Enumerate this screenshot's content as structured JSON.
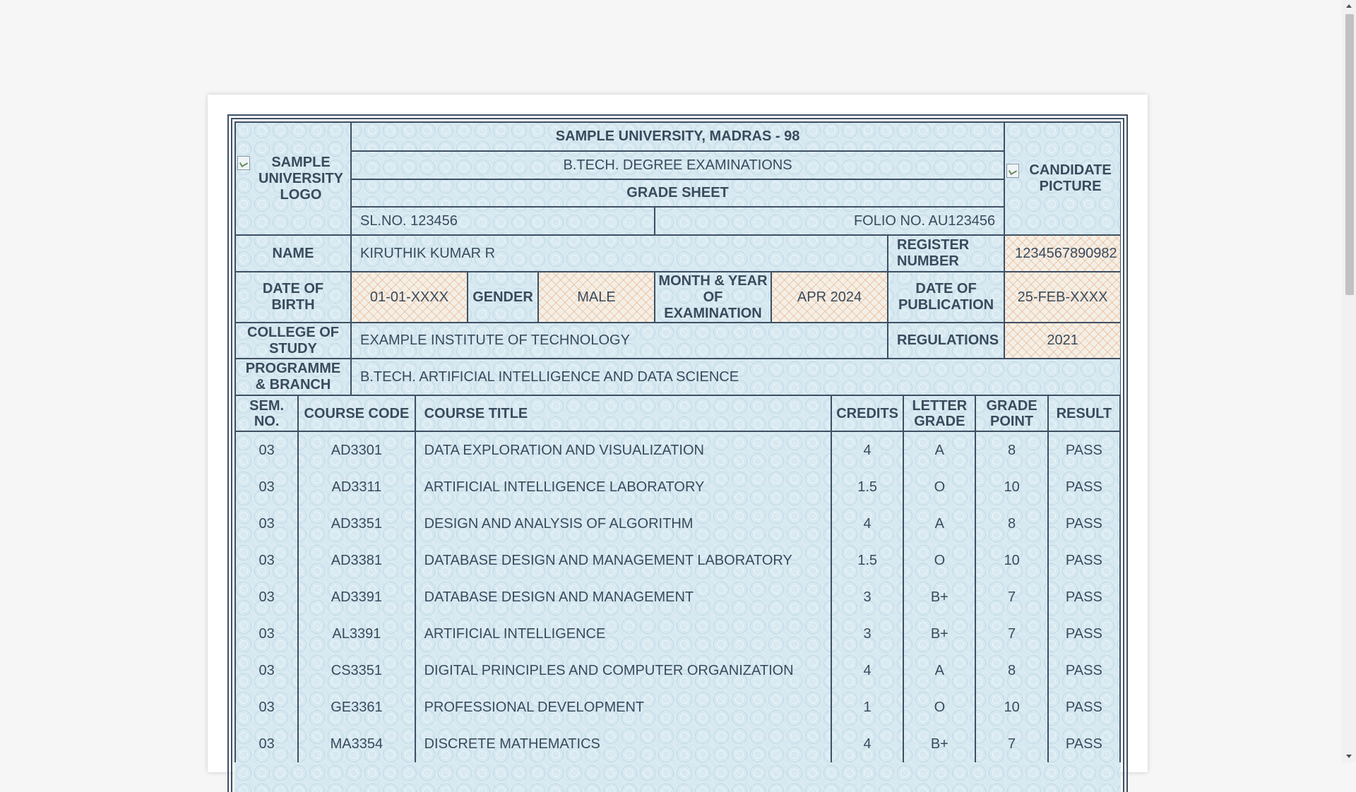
{
  "header": {
    "university": "SAMPLE UNIVERSITY, MADRAS - 98",
    "exam": "B.TECH. DEGREE EXAMINATIONS",
    "sheet_title": "GRADE SHEET",
    "sl_no": "SL.NO. 123456",
    "folio_no": "FOLIO NO. AU123456",
    "logo_alt": "SAMPLE UNIVERSITY LOGO",
    "picture_alt": "CANDIDATE PICTURE"
  },
  "student": {
    "name_label": "NAME",
    "name": "KIRUTHIK KUMAR R",
    "register_label": "REGISTER NUMBER",
    "register_number": "1234567890982",
    "dob_label": "DATE OF BIRTH",
    "dob": "01-01-XXXX",
    "gender_label": "GENDER",
    "gender": "MALE",
    "exam_month_label": "MONTH & YEAR OF EXAMINATION",
    "exam_month": "APR 2024",
    "publication_label": "DATE OF PUBLICATION",
    "publication_date": "25-FEB-XXXX",
    "college_label": "COLLEGE OF STUDY",
    "college": "EXAMPLE INSTITUTE OF TECHNOLOGY",
    "regulations_label": "REGULATIONS",
    "regulations": "2021",
    "programme_label": "PROGRAMME & BRANCH",
    "programme": "B.TECH. ARTIFICIAL INTELLIGENCE AND DATA SCIENCE"
  },
  "courses": {
    "headers": [
      "SEM. NO.",
      "COURSE CODE",
      "COURSE TITLE",
      "CREDITS",
      "LETTER GRADE",
      "GRADE POINT",
      "RESULT"
    ],
    "rows": [
      {
        "sem": "03",
        "code": "AD3301",
        "title": "DATA EXPLORATION AND VISUALIZATION",
        "credits": "4",
        "grade": "A",
        "point": "8",
        "result": "PASS"
      },
      {
        "sem": "03",
        "code": "AD3311",
        "title": "ARTIFICIAL INTELLIGENCE LABORATORY",
        "credits": "1.5",
        "grade": "O",
        "point": "10",
        "result": "PASS"
      },
      {
        "sem": "03",
        "code": "AD3351",
        "title": "DESIGN AND ANALYSIS OF ALGORITHM",
        "credits": "4",
        "grade": "A",
        "point": "8",
        "result": "PASS"
      },
      {
        "sem": "03",
        "code": "AD3381",
        "title": "DATABASE DESIGN AND MANAGEMENT LABORATORY",
        "credits": "1.5",
        "grade": "O",
        "point": "10",
        "result": "PASS"
      },
      {
        "sem": "03",
        "code": "AD3391",
        "title": "DATABASE DESIGN AND MANAGEMENT",
        "credits": "3",
        "grade": "B+",
        "point": "7",
        "result": "PASS"
      },
      {
        "sem": "03",
        "code": "AL3391",
        "title": "ARTIFICIAL INTELLIGENCE",
        "credits": "3",
        "grade": "B+",
        "point": "7",
        "result": "PASS"
      },
      {
        "sem": "03",
        "code": "CS3351",
        "title": "DIGITAL PRINCIPLES AND COMPUTER ORGANIZATION",
        "credits": "4",
        "grade": "A",
        "point": "8",
        "result": "PASS"
      },
      {
        "sem": "03",
        "code": "GE3361",
        "title": "PROFESSIONAL DEVELOPMENT",
        "credits": "1",
        "grade": "O",
        "point": "10",
        "result": "PASS"
      },
      {
        "sem": "03",
        "code": "MA3354",
        "title": "DISCRETE MATHEMATICS",
        "credits": "4",
        "grade": "B+",
        "point": "7",
        "result": "PASS"
      }
    ]
  }
}
